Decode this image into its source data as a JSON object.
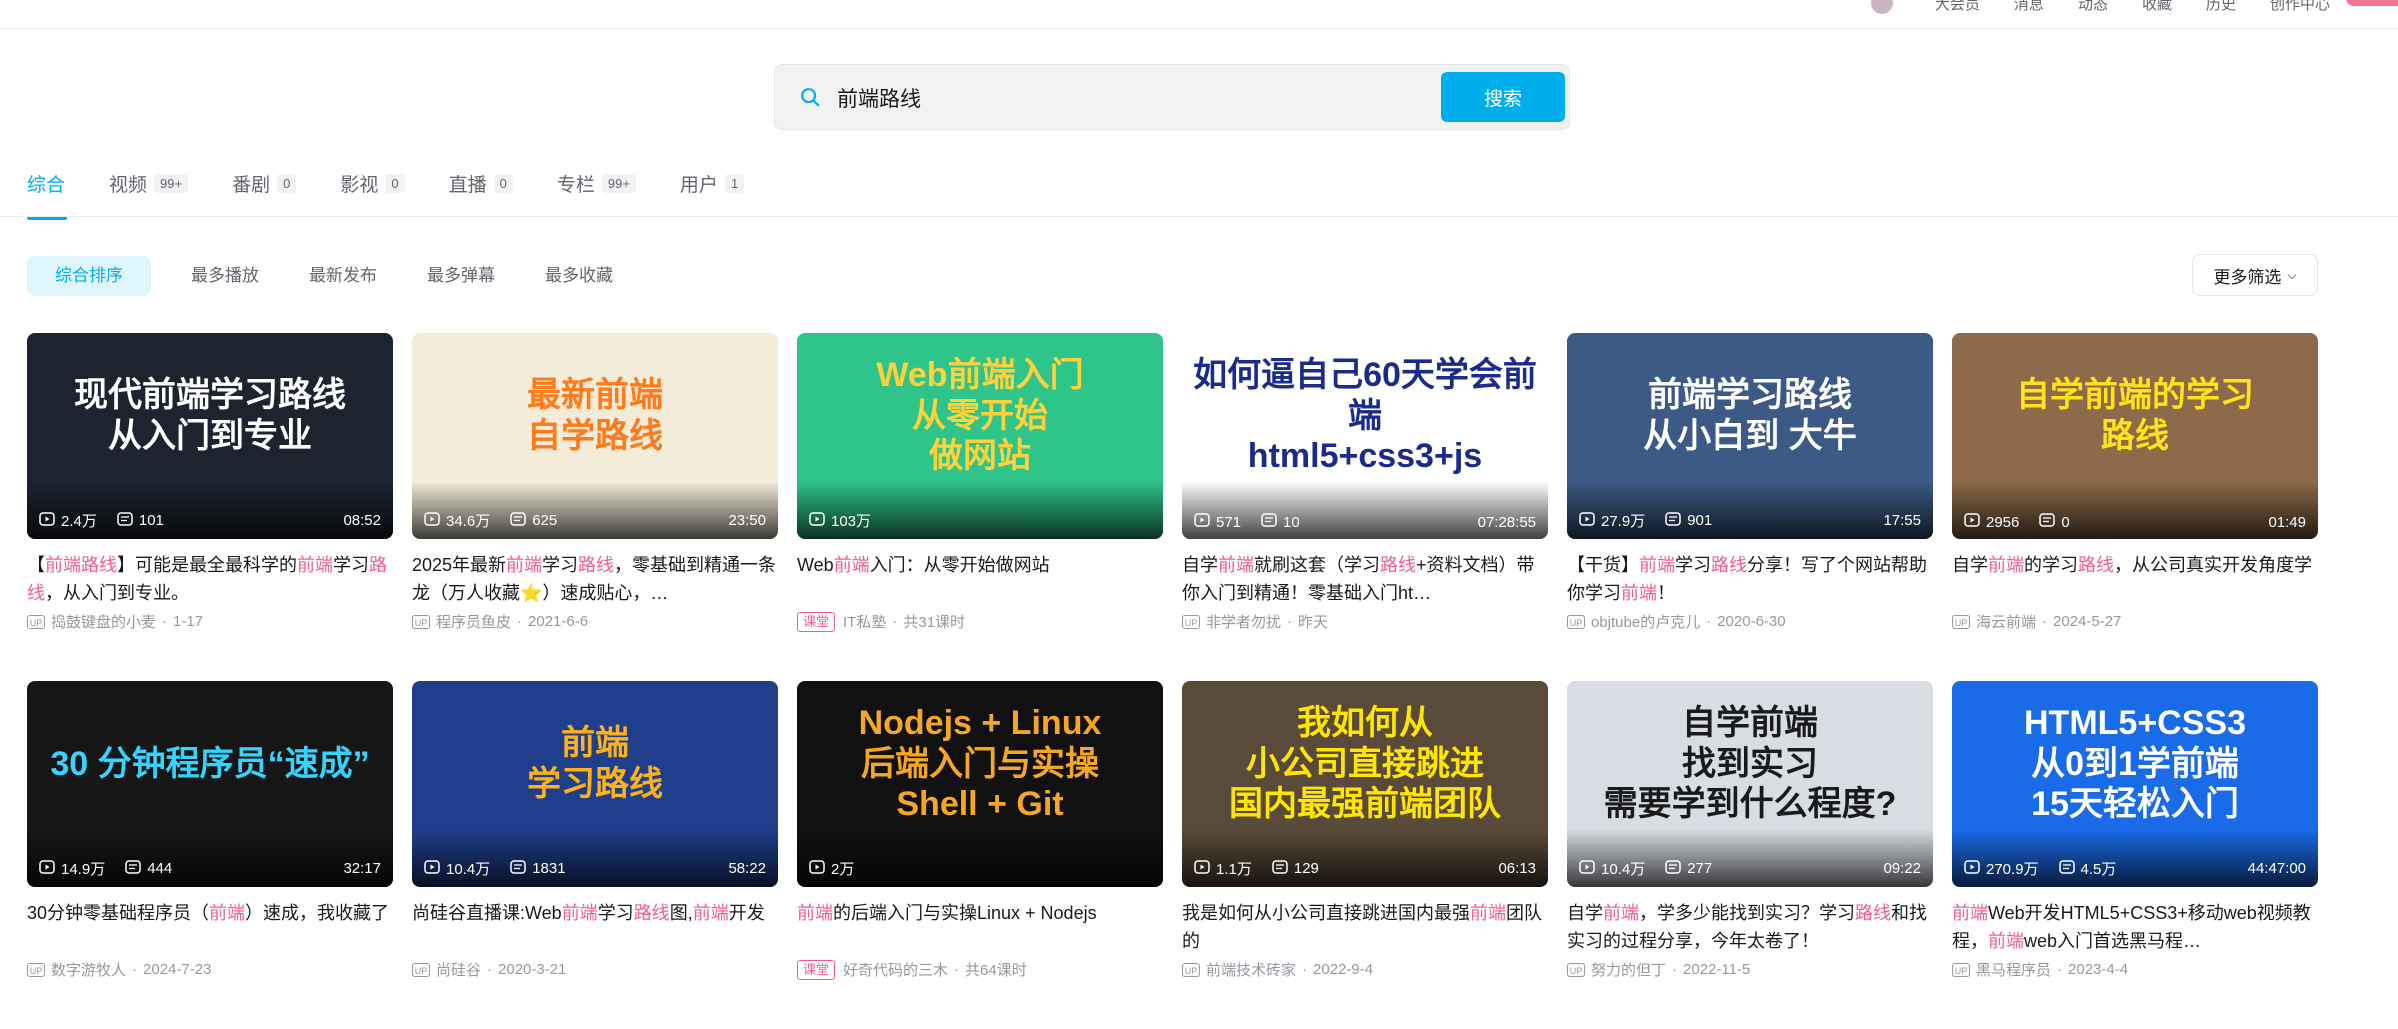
{
  "topnav": {
    "items": [
      "大会员",
      "消息",
      "动态",
      "收藏",
      "历史",
      "创作中心"
    ]
  },
  "search": {
    "query": "前端路线",
    "button_label": "搜索"
  },
  "tabs": [
    {
      "label": "综合",
      "count": ""
    },
    {
      "label": "视频",
      "count": "99+"
    },
    {
      "label": "番剧",
      "count": "0"
    },
    {
      "label": "影视",
      "count": "0"
    },
    {
      "label": "直播",
      "count": "0"
    },
    {
      "label": "专栏",
      "count": "99+"
    },
    {
      "label": "用户",
      "count": "1"
    }
  ],
  "sorts": [
    "综合排序",
    "最多播放",
    "最新发布",
    "最多弹幕",
    "最多收藏"
  ],
  "more_filter_label": "更多筛选",
  "videos": [
    {
      "thumb_text": "现代前端学习路线\n从入门到专业",
      "thumb_bg": "#1d2430",
      "thumb_fg": "#ffffff",
      "plays": "2.4万",
      "danmaku": "101",
      "duration": "08:52",
      "title": [
        [
          "【",
          ""
        ],
        [
          "前端路线",
          "hl"
        ],
        [
          "】可能是最全最科学的",
          ""
        ],
        [
          "前端",
          "hl"
        ],
        [
          "学习",
          ""
        ],
        [
          "路线",
          "hl"
        ],
        [
          "，从入门到专业。",
          ""
        ]
      ],
      "author": "捣鼓键盘的小麦",
      "date": "1-17",
      "course": false
    },
    {
      "thumb_text": "最新前端\n自学路线",
      "thumb_bg": "#f3ecd9",
      "thumb_fg": "#ff7a1a",
      "plays": "34.6万",
      "danmaku": "625",
      "duration": "23:50",
      "title": [
        [
          "2025年最新",
          ""
        ],
        [
          "前端",
          "hl"
        ],
        [
          "学习",
          ""
        ],
        [
          "路线",
          "hl"
        ],
        [
          "，零基础到精通一条龙（万人收藏⭐）速成贴心，…",
          ""
        ]
      ],
      "author": "程序员鱼皮",
      "date": "2021-6-6",
      "course": false
    },
    {
      "thumb_text": "Web前端入门\n从零开始\n做网站",
      "thumb_bg": "#2ec48a",
      "thumb_fg": "#ffd23c",
      "plays": "103万",
      "danmaku": "",
      "duration": "",
      "title": [
        [
          "Web",
          ""
        ],
        [
          "前端",
          "hl"
        ],
        [
          "入门：从零开始做网站",
          ""
        ]
      ],
      "author": "IT私塾",
      "date": "共31课时",
      "course": true,
      "course_label": "课堂"
    },
    {
      "thumb_text": "如何逼自己60天学会前端\nhtml5+css3+js",
      "thumb_bg": "#ffffff",
      "thumb_fg": "#1a2b8c",
      "plays": "571",
      "danmaku": "10",
      "duration": "07:28:55",
      "title": [
        [
          "自学",
          ""
        ],
        [
          "前端",
          "hl"
        ],
        [
          "就刷这套（学习",
          ""
        ],
        [
          "路线",
          "hl"
        ],
        [
          "+资料文档）带你入门到精通！零基础入门ht…",
          ""
        ]
      ],
      "author": "非学者勿扰",
      "date": "昨天",
      "course": false
    },
    {
      "thumb_text": "前端学习路线\n从小白到 大牛",
      "thumb_bg": "#3d5a86",
      "thumb_fg": "#ffffff",
      "plays": "27.9万",
      "danmaku": "901",
      "duration": "17:55",
      "title": [
        [
          "【干货】",
          ""
        ],
        [
          "前端",
          "hl"
        ],
        [
          "学习",
          ""
        ],
        [
          "路线",
          "hl"
        ],
        [
          "分享！写了个网站帮助你学习",
          ""
        ],
        [
          "前端",
          "hl"
        ],
        [
          "！",
          ""
        ]
      ],
      "author": "objtube的卢克儿",
      "date": "2020-6-30",
      "course": false
    },
    {
      "thumb_text": "自学前端的学习\n路线",
      "thumb_bg": "#8c6a4a",
      "thumb_fg": "#ffe21a",
      "plays": "2956",
      "danmaku": "0",
      "duration": "01:49",
      "title": [
        [
          "自学",
          ""
        ],
        [
          "前端",
          "hl"
        ],
        [
          "的学习",
          ""
        ],
        [
          "路线",
          "hl"
        ],
        [
          "，从公司真实开发角度学",
          ""
        ]
      ],
      "author": "海云前端",
      "date": "2024-5-27",
      "course": false
    },
    {
      "thumb_text": "30 分钟程序员“速成”",
      "thumb_bg": "#161616",
      "thumb_fg": "#35d4ff",
      "plays": "14.9万",
      "danmaku": "444",
      "duration": "32:17",
      "title": [
        [
          "30分钟零基础程序员（",
          ""
        ],
        [
          "前端",
          "hl"
        ],
        [
          "）速成，我收藏了",
          ""
        ]
      ],
      "author": "数字游牧人",
      "date": "2024-7-23",
      "course": false
    },
    {
      "thumb_text": "前端\n学习路线",
      "thumb_bg": "#1f3f8c",
      "thumb_fg": "#ffb11a",
      "plays": "10.4万",
      "danmaku": "1831",
      "duration": "58:22",
      "title": [
        [
          "尚硅谷直播课:Web",
          ""
        ],
        [
          "前端",
          "hl"
        ],
        [
          "学习",
          ""
        ],
        [
          "路线",
          "hl"
        ],
        [
          "图,",
          ""
        ],
        [
          "前端",
          "hl"
        ],
        [
          "开发",
          ""
        ]
      ],
      "author": "尚硅谷",
      "date": "2020-3-21",
      "course": false
    },
    {
      "thumb_text": "Nodejs + Linux\n后端入门与实操\nShell + Git",
      "thumb_bg": "#111111",
      "thumb_fg": "#f5a623",
      "plays": "2万",
      "danmaku": "",
      "duration": "",
      "title": [
        [
          "前端",
          "hl"
        ],
        [
          "的后端入门与实操Linux + Nodejs",
          ""
        ]
      ],
      "author": "好奇代码的三木",
      "date": "共64课时",
      "course": true,
      "course_label": "课堂"
    },
    {
      "thumb_text": "我如何从\n小公司直接跳进\n国内最强前端团队",
      "thumb_bg": "#5a4a3a",
      "thumb_fg": "#ffe600",
      "plays": "1.1万",
      "danmaku": "129",
      "duration": "06:13",
      "title": [
        [
          "我是如何从小公司直接跳进国内最强",
          ""
        ],
        [
          "前端",
          "hl"
        ],
        [
          "团队的",
          ""
        ]
      ],
      "author": "前端技术砖家",
      "date": "2022-9-4",
      "course": false
    },
    {
      "thumb_text": "自学前端\n找到实习\n需要学到什么程度?",
      "thumb_bg": "#d8dde4",
      "thumb_fg": "#1a1a1a",
      "plays": "10.4万",
      "danmaku": "277",
      "duration": "09:22",
      "title": [
        [
          "自学",
          ""
        ],
        [
          "前端",
          "hl"
        ],
        [
          "，学多少能找到实习？学习",
          ""
        ],
        [
          "路线",
          "hl"
        ],
        [
          "和找实习的过程分享，今年太卷了！",
          ""
        ]
      ],
      "author": "努力的但丁",
      "date": "2022-11-5",
      "course": false
    },
    {
      "thumb_text": "HTML5+CSS3\n从0到1学前端\n15天轻松入门",
      "thumb_bg": "#1a6be8",
      "thumb_fg": "#ffffff",
      "plays": "270.9万",
      "danmaku": "4.5万",
      "duration": "44:47:00",
      "title": [
        [
          "前端",
          "hl"
        ],
        [
          "Web开发HTML5+CSS3+移动web视频教程，",
          ""
        ],
        [
          "前端",
          "hl"
        ],
        [
          "web入门首选黑马程…",
          ""
        ]
      ],
      "author": "黑马程序员",
      "date": "2023-4-4",
      "course": false
    }
  ],
  "colors": {
    "accent": "#00aeec",
    "highlight": "#f25d8e",
    "meta": "#9499a0"
  },
  "icons": {
    "search": "search-icon",
    "play": "play-count-icon",
    "danmaku": "danmaku-icon",
    "up": "up-icon",
    "chevron": "chevron-down-icon"
  }
}
